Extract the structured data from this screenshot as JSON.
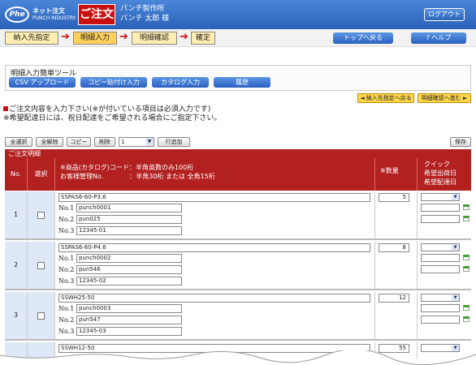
{
  "header": {
    "logo_mark": "Phe",
    "logo_line1": "ネット注文",
    "logo_line2": "PUNCH INDUSTRY",
    "title": "ご注文",
    "company": "パンチ製作所",
    "user": "パンチ 太郎 様",
    "logout": "ログアウト"
  },
  "steps": [
    {
      "label": "納入先指定"
    },
    {
      "label": "明細入力"
    },
    {
      "label": "明細確認"
    },
    {
      "label": "確定"
    }
  ],
  "nav": {
    "top_back": "トップへ戻る",
    "help": "? ヘルプ"
  },
  "tools": {
    "title": "明細入力簡単ツール",
    "buttons": [
      "CSV アップロード",
      "コピー貼付け入力",
      "カタログ入力",
      "履歴"
    ]
  },
  "page_nav": {
    "back": "◄ 納入先指定へ戻る",
    "next": "明細確認へ進む ►"
  },
  "notice": {
    "line1": "ご注文内容を入力下さい(※が付いている項目は必須入力です)",
    "line2": "※希望配達日には、祝日配達をご希望される場合にご指定下さい。"
  },
  "actions": {
    "select_all": "全選択",
    "deselect_all": "全解除",
    "copy": "コピー",
    "delete": "削除",
    "row_count": "1",
    "add_row": "行追加",
    "save": "保存"
  },
  "table": {
    "title": "ご注文明細",
    "headers": {
      "no": "No.",
      "select": "選択",
      "product_line1": "※商品(カタログ)コード：半角英数のみ100桁",
      "product_line2": "お客様管理No.　　　　：半角30桁 または 全角15桁",
      "qty": "※数量",
      "quick": "クイック",
      "ship_date": "希望出荷日",
      "delivery_date": "希望配達日"
    },
    "rows": [
      {
        "no": "1",
        "code": "SSPAS6-60-P3.6",
        "qty": "5",
        "n1_label": "No.1",
        "n1": "punch0001",
        "n2_label": "No.2",
        "n2": "pun025",
        "n3_label": "No.3",
        "n3": "12345-01"
      },
      {
        "no": "2",
        "code": "SSPAS6-60-P4.6",
        "qty": "8",
        "n1_label": "No.1",
        "n1": "punch0002",
        "n2_label": "No.2",
        "n2": "pun546",
        "n3_label": "No.3",
        "n3": "12345-02"
      },
      {
        "no": "3",
        "code": "SSWH25-50",
        "qty": "12",
        "n1_label": "No.1",
        "n1": "punch0003",
        "n2_label": "No.2",
        "n2": "pun547",
        "n3_label": "No.3",
        "n3": "12345-03"
      },
      {
        "no": "",
        "code": "SSWH12-50",
        "qty": "55"
      }
    ]
  },
  "colors": {
    "header_blue": "#2a62b8",
    "table_red": "#b22020",
    "step_active": "#ffd05a"
  }
}
